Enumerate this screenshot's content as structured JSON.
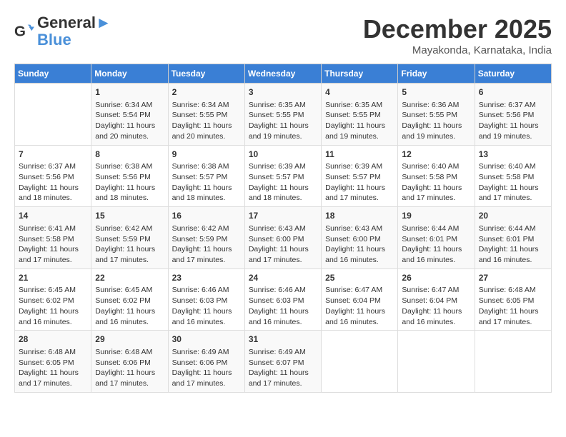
{
  "header": {
    "logo_line1": "General",
    "logo_line2": "Blue",
    "month": "December 2025",
    "location": "Mayakonda, Karnataka, India"
  },
  "days_of_week": [
    "Sunday",
    "Monday",
    "Tuesday",
    "Wednesday",
    "Thursday",
    "Friday",
    "Saturday"
  ],
  "weeks": [
    [
      {
        "day": "",
        "info": ""
      },
      {
        "day": "1",
        "info": "Sunrise: 6:34 AM\nSunset: 5:54 PM\nDaylight: 11 hours\nand 20 minutes."
      },
      {
        "day": "2",
        "info": "Sunrise: 6:34 AM\nSunset: 5:55 PM\nDaylight: 11 hours\nand 20 minutes."
      },
      {
        "day": "3",
        "info": "Sunrise: 6:35 AM\nSunset: 5:55 PM\nDaylight: 11 hours\nand 19 minutes."
      },
      {
        "day": "4",
        "info": "Sunrise: 6:35 AM\nSunset: 5:55 PM\nDaylight: 11 hours\nand 19 minutes."
      },
      {
        "day": "5",
        "info": "Sunrise: 6:36 AM\nSunset: 5:55 PM\nDaylight: 11 hours\nand 19 minutes."
      },
      {
        "day": "6",
        "info": "Sunrise: 6:37 AM\nSunset: 5:56 PM\nDaylight: 11 hours\nand 19 minutes."
      }
    ],
    [
      {
        "day": "7",
        "info": "Sunrise: 6:37 AM\nSunset: 5:56 PM\nDaylight: 11 hours\nand 18 minutes."
      },
      {
        "day": "8",
        "info": "Sunrise: 6:38 AM\nSunset: 5:56 PM\nDaylight: 11 hours\nand 18 minutes."
      },
      {
        "day": "9",
        "info": "Sunrise: 6:38 AM\nSunset: 5:57 PM\nDaylight: 11 hours\nand 18 minutes."
      },
      {
        "day": "10",
        "info": "Sunrise: 6:39 AM\nSunset: 5:57 PM\nDaylight: 11 hours\nand 18 minutes."
      },
      {
        "day": "11",
        "info": "Sunrise: 6:39 AM\nSunset: 5:57 PM\nDaylight: 11 hours\nand 17 minutes."
      },
      {
        "day": "12",
        "info": "Sunrise: 6:40 AM\nSunset: 5:58 PM\nDaylight: 11 hours\nand 17 minutes."
      },
      {
        "day": "13",
        "info": "Sunrise: 6:40 AM\nSunset: 5:58 PM\nDaylight: 11 hours\nand 17 minutes."
      }
    ],
    [
      {
        "day": "14",
        "info": "Sunrise: 6:41 AM\nSunset: 5:58 PM\nDaylight: 11 hours\nand 17 minutes."
      },
      {
        "day": "15",
        "info": "Sunrise: 6:42 AM\nSunset: 5:59 PM\nDaylight: 11 hours\nand 17 minutes."
      },
      {
        "day": "16",
        "info": "Sunrise: 6:42 AM\nSunset: 5:59 PM\nDaylight: 11 hours\nand 17 minutes."
      },
      {
        "day": "17",
        "info": "Sunrise: 6:43 AM\nSunset: 6:00 PM\nDaylight: 11 hours\nand 17 minutes."
      },
      {
        "day": "18",
        "info": "Sunrise: 6:43 AM\nSunset: 6:00 PM\nDaylight: 11 hours\nand 16 minutes."
      },
      {
        "day": "19",
        "info": "Sunrise: 6:44 AM\nSunset: 6:01 PM\nDaylight: 11 hours\nand 16 minutes."
      },
      {
        "day": "20",
        "info": "Sunrise: 6:44 AM\nSunset: 6:01 PM\nDaylight: 11 hours\nand 16 minutes."
      }
    ],
    [
      {
        "day": "21",
        "info": "Sunrise: 6:45 AM\nSunset: 6:02 PM\nDaylight: 11 hours\nand 16 minutes."
      },
      {
        "day": "22",
        "info": "Sunrise: 6:45 AM\nSunset: 6:02 PM\nDaylight: 11 hours\nand 16 minutes."
      },
      {
        "day": "23",
        "info": "Sunrise: 6:46 AM\nSunset: 6:03 PM\nDaylight: 11 hours\nand 16 minutes."
      },
      {
        "day": "24",
        "info": "Sunrise: 6:46 AM\nSunset: 6:03 PM\nDaylight: 11 hours\nand 16 minutes."
      },
      {
        "day": "25",
        "info": "Sunrise: 6:47 AM\nSunset: 6:04 PM\nDaylight: 11 hours\nand 16 minutes."
      },
      {
        "day": "26",
        "info": "Sunrise: 6:47 AM\nSunset: 6:04 PM\nDaylight: 11 hours\nand 16 minutes."
      },
      {
        "day": "27",
        "info": "Sunrise: 6:48 AM\nSunset: 6:05 PM\nDaylight: 11 hours\nand 17 minutes."
      }
    ],
    [
      {
        "day": "28",
        "info": "Sunrise: 6:48 AM\nSunset: 6:05 PM\nDaylight: 11 hours\nand 17 minutes."
      },
      {
        "day": "29",
        "info": "Sunrise: 6:48 AM\nSunset: 6:06 PM\nDaylight: 11 hours\nand 17 minutes."
      },
      {
        "day": "30",
        "info": "Sunrise: 6:49 AM\nSunset: 6:06 PM\nDaylight: 11 hours\nand 17 minutes."
      },
      {
        "day": "31",
        "info": "Sunrise: 6:49 AM\nSunset: 6:07 PM\nDaylight: 11 hours\nand 17 minutes."
      },
      {
        "day": "",
        "info": ""
      },
      {
        "day": "",
        "info": ""
      },
      {
        "day": "",
        "info": ""
      }
    ]
  ]
}
